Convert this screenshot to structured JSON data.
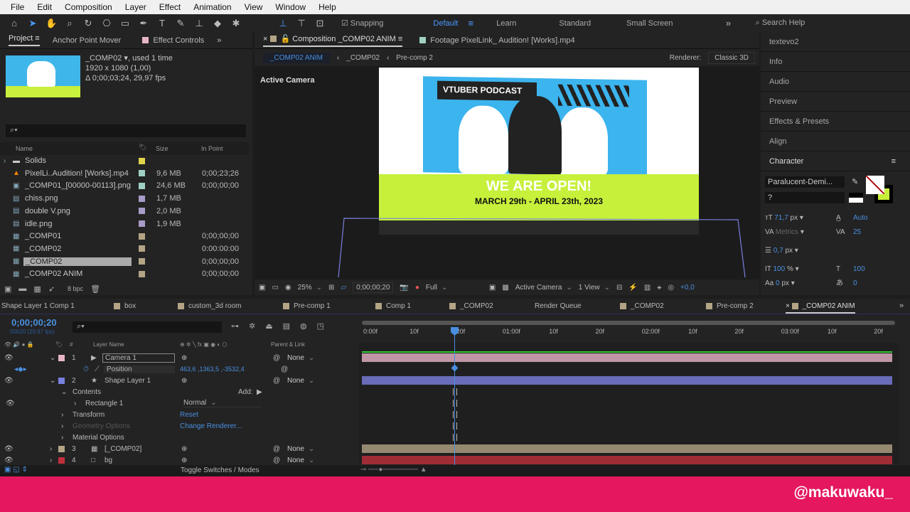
{
  "menu": [
    "File",
    "Edit",
    "Composition",
    "Layer",
    "Effect",
    "Animation",
    "View",
    "Window",
    "Help"
  ],
  "toolbar": {
    "snapping": "Snapping",
    "workspaces": [
      "Default",
      "Learn",
      "Standard",
      "Small Screen"
    ],
    "search": "Search Help"
  },
  "project": {
    "tabs": [
      "Project",
      "Anchor Point Mover",
      "Effect Controls"
    ],
    "selected_name": "_COMP02",
    "used": ", used 1 time",
    "resolution": "1920 x 1080 (1,00)",
    "duration": "Δ 0;00;03;24, 29,97 fps",
    "columns": {
      "name": "Name",
      "size": "Size",
      "in_point": "In Point"
    },
    "items": [
      {
        "name": "Solids",
        "size": "",
        "in": "",
        "color": "#e0d44a",
        "icon": "folder-icon"
      },
      {
        "name": "PixelLi..Audition! [Works].mp4",
        "size": "9,6 MB",
        "in": "0;00;23;26",
        "color": "#9fd0c4",
        "icon": "vlc-icon"
      },
      {
        "name": "_COMP01_[00000-00113].png",
        "size": "24,6 MB",
        "in": "0;00;00;00",
        "color": "#9fd0c4",
        "icon": "image-sequence-icon"
      },
      {
        "name": "chiss.png",
        "size": "1,7 MB",
        "in": "",
        "color": "#a79bc8",
        "icon": "image-icon"
      },
      {
        "name": "double V.png",
        "size": "2,0 MB",
        "in": "",
        "color": "#a79bc8",
        "icon": "image-icon"
      },
      {
        "name": "idle.png",
        "size": "1,9 MB",
        "in": "",
        "color": "#a79bc8",
        "icon": "image-icon"
      },
      {
        "name": "_COMP01",
        "size": "",
        "in": "0;00;00;00",
        "color": "#b3a486",
        "icon": "comp-icon"
      },
      {
        "name": "_COMP02",
        "size": "",
        "in": "0:00:00:00",
        "color": "#b3a486",
        "icon": "comp-icon"
      },
      {
        "name": "_COMP02",
        "size": "",
        "in": "0;00;00;00",
        "color": "#b3a486",
        "icon": "comp-icon",
        "selected": true
      },
      {
        "name": "_COMP02 ANIM",
        "size": "",
        "in": "0;00;00;00",
        "color": "#b3a486",
        "icon": "comp-icon"
      }
    ],
    "bpc": "8 bpc"
  },
  "viewer": {
    "tabs": [
      "Composition _COMP02 ANIM",
      "Footage PixelLink_ Audition! [Works].mp4"
    ],
    "breadcrumbs": [
      "_COMP02 ANIM",
      "_COMP02",
      "Pre-comp 2"
    ],
    "renderer_label": "Renderer:",
    "renderer": "Classic 3D",
    "camera_label": "Active Camera",
    "art": {
      "podcast": "VTUBER PODCAST",
      "headline": "WE ARE OPEN!",
      "dates": "MARCH 29th - APRIL 23th, 2023"
    },
    "zoom": "25%",
    "time": "0;00;00;20",
    "resolution": "Full",
    "camera": "Active Camera",
    "views": "1 View",
    "exposure": "+0,0"
  },
  "right": {
    "panels": [
      "textevo2",
      "Info",
      "Audio",
      "Preview",
      "Effects & Presets",
      "Align"
    ],
    "character": {
      "title": "Character",
      "font": "Paralucent-Demi...",
      "style": "?",
      "size": "71,7",
      "size_unit": "px",
      "leading": "Auto",
      "kerning": "Metrics",
      "tracking": "25",
      "stroke": "0,7",
      "stroke_unit": "px",
      "vscale": "100",
      "hscale": "100",
      "baseline": "0",
      "baseline_unit": "px",
      "tsume": "0",
      "pct": "%"
    }
  },
  "timeline": {
    "tabs": [
      "Shape Layer 1 Comp 1",
      "box",
      "custom_3d room",
      "Pre-comp 1",
      "Comp 1",
      "_COMP02",
      "Render Queue",
      "_COMP02",
      "Pre-comp 2",
      "_COMP02 ANIM"
    ],
    "timecode": "0;00;00;20",
    "frames": "00020 (29.97 fps)",
    "headers": {
      "layer_name": "Layer Name",
      "parent": "Parent & Link",
      "num": "#"
    },
    "ruler": [
      "0:00f",
      "10f",
      "20f",
      "01:00f",
      "10f",
      "20f",
      "02:00f",
      "10f",
      "20f",
      "03:00f",
      "10f",
      "20f"
    ],
    "layers": [
      {
        "num": "1",
        "name": "Camera 1",
        "parent": "None",
        "color": "#e8b4c8"
      },
      {
        "num": "2",
        "name": "Shape Layer 1",
        "parent": "None",
        "color": "#7a80e0"
      },
      {
        "num": "3",
        "name": "[_COMP02]",
        "parent": "None",
        "color": "#b3a486"
      },
      {
        "num": "4",
        "name": "bg",
        "parent": "None",
        "color": "#c0303c"
      }
    ],
    "position": {
      "label": "Position",
      "value": "463,6 ,1363,5 ,-3532,4"
    },
    "contents": "Contents",
    "add": "Add:",
    "rectangle": "Rectangle 1",
    "blend": "Normal",
    "transform": "Transform",
    "reset": "Reset",
    "geometry": "Geometry Options",
    "change_renderer": "Change Renderer...",
    "material": "Material Options",
    "toggle": "Toggle Switches / Modes"
  },
  "watermark": "@makuwaku_"
}
